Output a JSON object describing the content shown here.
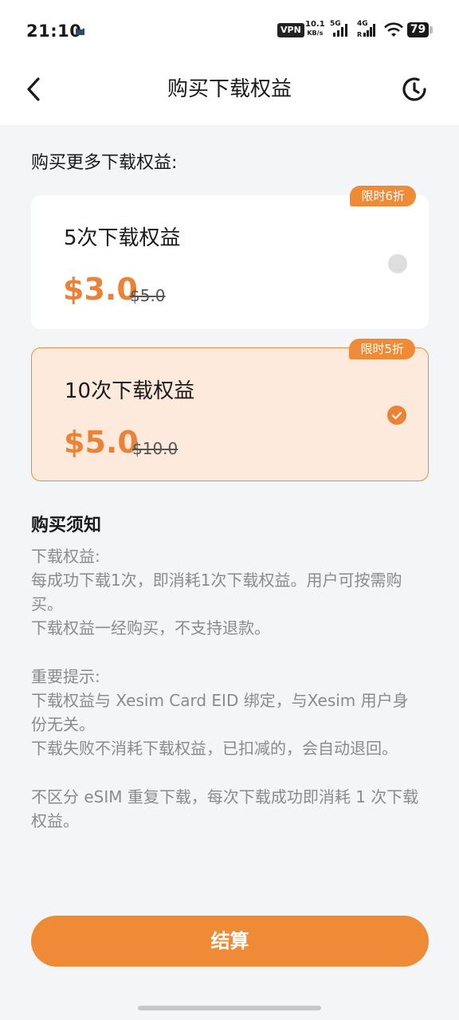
{
  "status_bar": {
    "time": "21:10",
    "vpn": "VPN",
    "speed_value": "10.1",
    "speed_unit": "KB/s",
    "sim1": "5G",
    "sim2": "4G",
    "battery": "79"
  },
  "header": {
    "title": "购买下载权益"
  },
  "section": {
    "title": "购买更多下载权益:"
  },
  "plans": [
    {
      "name": "5次下载权益",
      "price": "$3.0",
      "original_price": "$5.0",
      "badge": "限时6折",
      "selected": false
    },
    {
      "name": "10次下载权益",
      "price": "$5.0",
      "original_price": "$10.0",
      "badge": "限时5折",
      "selected": true
    }
  ],
  "notice": {
    "title": "购买须知",
    "lines": [
      "下载权益:",
      "每成功下载1次，即消耗1次下载权益。用户可按需购买。",
      "下载权益一经购买，不支持退款。",
      "重要提示:",
      "下载权益与 Xesim Card EID 绑定，与Xesim 用户身份无关。",
      "下载失败不消耗下载权益，已扣减的，会自动退回。",
      "不区分 eSIM 重复下载，每次下载成功即消耗 1 次下载权益。"
    ]
  },
  "checkout": {
    "label": "结算"
  },
  "colors": {
    "accent": "#ef8a36",
    "price": "#ec8235",
    "selected_bg": "#fdeadd",
    "page_bg": "#f4f5f7"
  }
}
